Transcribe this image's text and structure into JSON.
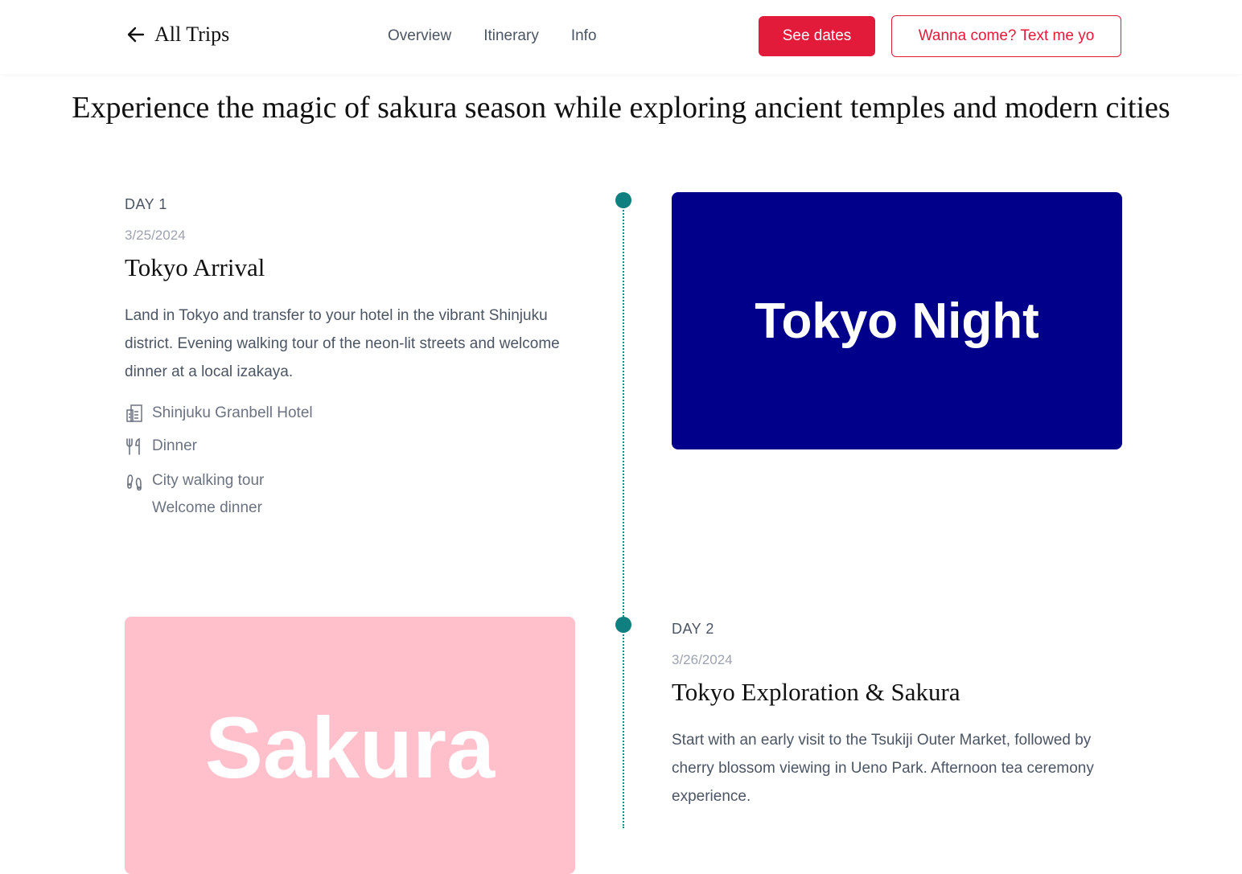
{
  "header": {
    "back_label": "All Trips",
    "nav": [
      "Overview",
      "Itinerary",
      "Info"
    ],
    "see_dates_label": "See dates",
    "contact_label": "Wanna come? Text me yo"
  },
  "headline": "Experience the magic of sakura season while exploring ancient temples and modern cities",
  "colors": {
    "accent": "#e31b3b",
    "timeline": "#0f7f7f",
    "day1_image_bg": "#00008b",
    "day2_image_bg": "#ffc0cb"
  },
  "days": [
    {
      "day_label": "DAY 1",
      "date": "3/25/2024",
      "title": "Tokyo Arrival",
      "description": "Land in Tokyo and transfer to your hotel in the vibrant Shinjuku district. Evening walking tour of the neon-lit streets and welcome dinner at a local izakaya.",
      "hotel": "Shinjuku Granbell Hotel",
      "meals": "Dinner",
      "activities": [
        "City walking tour",
        "Welcome dinner"
      ],
      "image_text": "Tokyo Night"
    },
    {
      "day_label": "DAY 2",
      "date": "3/26/2024",
      "title": "Tokyo Exploration & Sakura",
      "description": "Start with an early visit to the Tsukiji Outer Market, followed by cherry blossom viewing in Ueno Park. Afternoon tea ceremony experience.",
      "image_text": "Sakura"
    }
  ]
}
